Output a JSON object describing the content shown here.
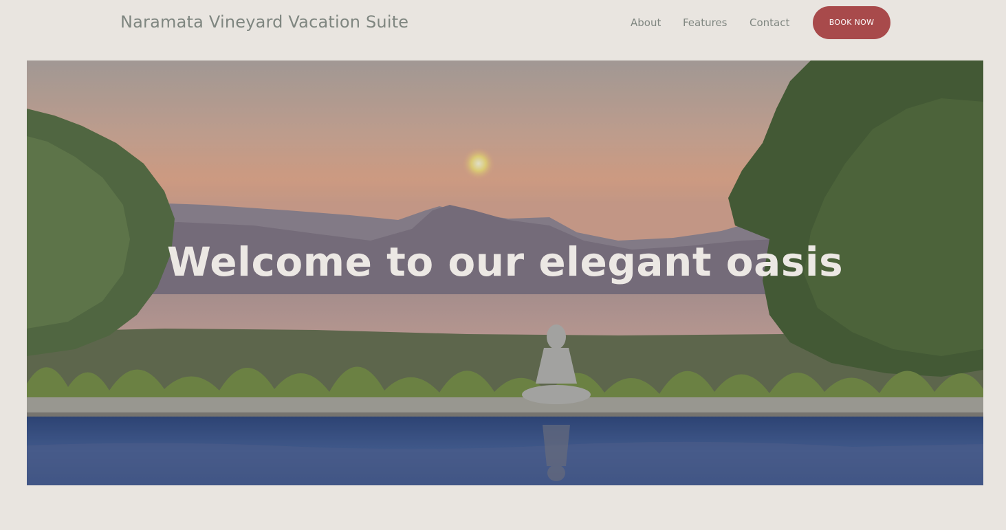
{
  "header": {
    "site_title": "Naramata Vineyard Vacation Suite",
    "nav": {
      "about": "About",
      "features": "Features",
      "contact": "Contact"
    },
    "book_button": "BOOK NOW"
  },
  "hero": {
    "heading": "Welcome to our elegant oasis",
    "image_description_icon": "sunset-lake-pool-buddha-image"
  },
  "colors": {
    "background": "#e9e5e0",
    "nav_text": "#7f8680",
    "accent": "#a84a4b",
    "hero_text": "#ece8e4"
  }
}
